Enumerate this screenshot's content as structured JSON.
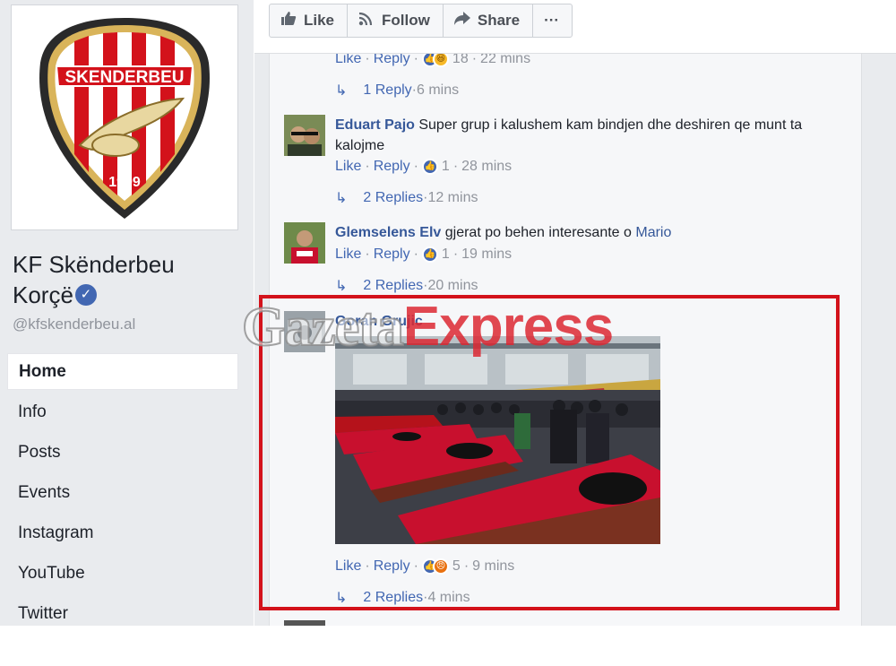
{
  "page": {
    "name": "KF Skënderbeu Korçë",
    "handle": "@kfskenderbeu.al",
    "logo": {
      "banner_text": "SKENDERBEU",
      "year": "1909"
    }
  },
  "nav": {
    "items": [
      {
        "label": "Home",
        "active": true
      },
      {
        "label": "Info"
      },
      {
        "label": "Posts"
      },
      {
        "label": "Events"
      },
      {
        "label": "Instagram"
      },
      {
        "label": "YouTube"
      },
      {
        "label": "Twitter"
      }
    ]
  },
  "actions": {
    "like": "Like",
    "follow": "Follow",
    "share": "Share",
    "more": "···"
  },
  "comments": {
    "c0": {
      "like": "Like",
      "reply": "Reply",
      "reactions": "18",
      "time": "22 mins",
      "replies": "1 Reply",
      "replies_time": "6 mins"
    },
    "c1": {
      "author": "Eduart Pajo",
      "text": "Super grup i kalushem kam bindjen dhe deshiren qe munt ta kalojme",
      "like": "Like",
      "reply": "Reply",
      "reactions": "1",
      "time": "28 mins",
      "replies": "2 Replies",
      "replies_time": "12 mins"
    },
    "c2": {
      "author": "Glemselens Elv",
      "text": "gjerat po behen interesante o ",
      "mention": "Mario",
      "like": "Like",
      "reply": "Reply",
      "reactions": "1",
      "time": "19 mins",
      "replies": "2 Replies",
      "replies_time": "20 mins"
    },
    "c3": {
      "author": "Goran Grujic",
      "like": "Like",
      "reply": "Reply",
      "reactions": "5",
      "time": "9 mins",
      "replies": "2 Replies",
      "replies_time": "4 mins"
    }
  },
  "watermark": {
    "part1": "Gazeta",
    "part2": "Express"
  },
  "colors": {
    "fb_blue": "#4267b2",
    "link_blue": "#365899",
    "sidebar_bg": "#e9ebee",
    "highlight_red": "#d3121b",
    "flag_red": "#c8102e"
  },
  "icons": {
    "like": "thumbs-up-icon",
    "follow": "rss-icon",
    "share": "share-arrow-icon",
    "reply_arrow": "reply-arrow-icon",
    "verified": "verified-check-icon"
  }
}
